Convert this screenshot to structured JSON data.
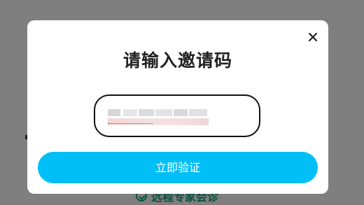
{
  "modal": {
    "title": "请输入邀请码",
    "close_icon": "close-icon",
    "invite_code_input": {
      "value": "",
      "placeholder": ""
    },
    "verify_button_label": "立即验证"
  },
  "background_page": {
    "link_label": "远程专家会诊",
    "link_icon": "check-circle-icon"
  },
  "colors": {
    "overlay": "#000000",
    "button": "#00bff7",
    "title": "#222222"
  }
}
